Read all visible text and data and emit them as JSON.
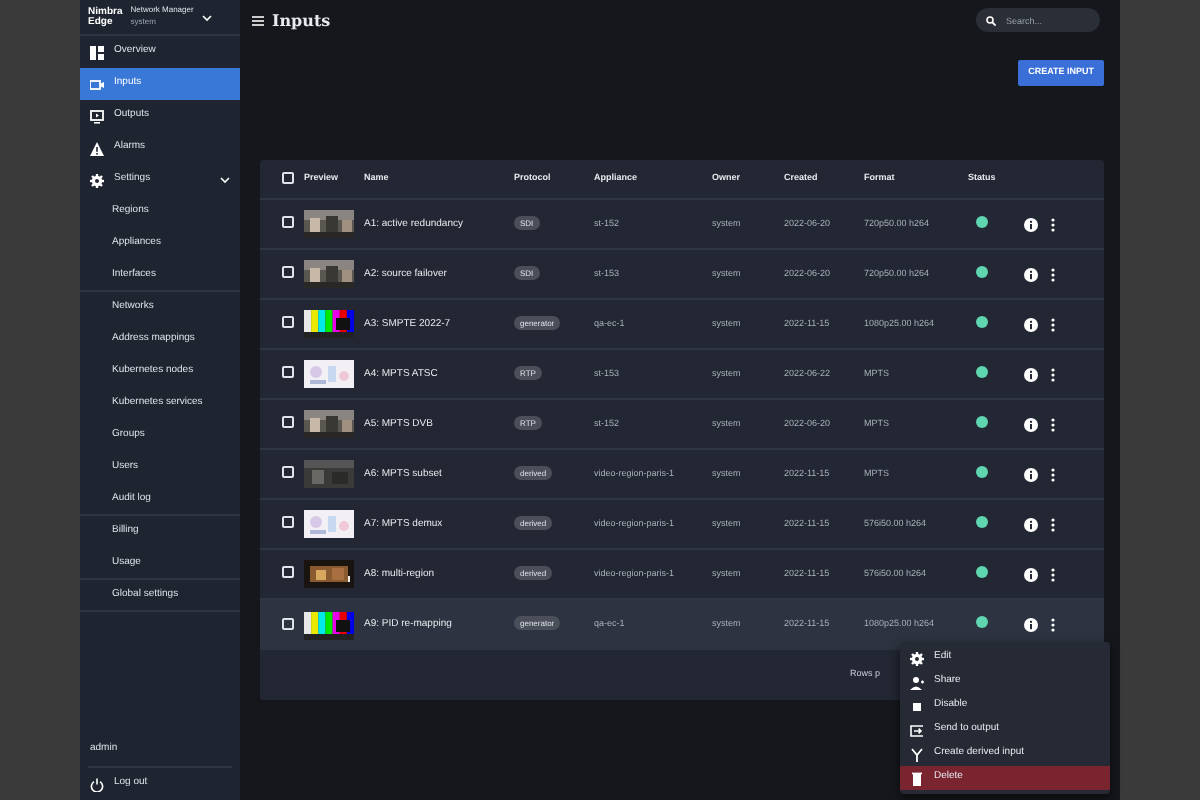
{
  "brand": {
    "logo_lines": [
      "Nimbra",
      "Edge"
    ],
    "product": "Network Manager",
    "subtitle": "system"
  },
  "sidebar": {
    "items": [
      {
        "label": "Overview",
        "selected": false
      },
      {
        "label": "Inputs",
        "selected": true
      },
      {
        "label": "Outputs",
        "selected": false
      },
      {
        "label": "Alarms",
        "selected": false
      },
      {
        "label": "Settings",
        "selected": false,
        "expanded": true,
        "children": [
          {
            "label": "Regions",
            "divider_after": false
          },
          {
            "label": "Appliances",
            "divider_after": false
          },
          {
            "label": "Interfaces",
            "divider_after": true
          },
          {
            "label": "Networks",
            "divider_after": false
          },
          {
            "label": "Address mappings",
            "divider_after": false
          },
          {
            "label": "Kubernetes nodes",
            "divider_after": false
          },
          {
            "label": "Kubernetes services",
            "divider_after": false
          },
          {
            "label": "Groups",
            "divider_after": false
          },
          {
            "label": "Users",
            "divider_after": false
          },
          {
            "label": "Audit log",
            "divider_after": true
          },
          {
            "label": "Billing",
            "divider_after": false
          },
          {
            "label": "Usage",
            "divider_after": true
          },
          {
            "label": "Global settings",
            "divider_after": true
          }
        ]
      }
    ],
    "user": "admin",
    "logout": "Log out"
  },
  "page": {
    "title": "Inputs",
    "search_placeholder": "Search...",
    "create_button": "CREATE INPUT"
  },
  "table": {
    "select_all_checked": false,
    "columns": [
      "",
      "Preview",
      "Name",
      "Protocol",
      "Appliance",
      "Owner",
      "Created",
      "Format",
      "Status",
      ""
    ],
    "rows": [
      {
        "checked": false,
        "selected": false,
        "name": "A1: active redundancy",
        "protocol": "SDI",
        "appliance": "st-152",
        "owner": "system",
        "created": "2022-06-20",
        "format": "720p50.00 h264",
        "online": true
      },
      {
        "checked": false,
        "selected": false,
        "name": "A2: source failover",
        "protocol": "SDI",
        "appliance": "st-153",
        "owner": "system",
        "created": "2022-06-20",
        "format": "720p50.00 h264",
        "online": true
      },
      {
        "checked": false,
        "selected": false,
        "name": "A3: SMPTE 2022-7",
        "protocol": "generator",
        "appliance": "qa-ec-1",
        "owner": "system",
        "created": "2022-11-15",
        "format": "1080p25.00 h264",
        "online": true
      },
      {
        "checked": false,
        "selected": false,
        "name": "A4: MPTS ATSC",
        "protocol": "RTP",
        "appliance": "st-153",
        "owner": "system",
        "created": "2022-06-22",
        "format": "MPTS",
        "online": true
      },
      {
        "checked": false,
        "selected": false,
        "name": "A5: MPTS DVB",
        "protocol": "RTP",
        "appliance": "st-152",
        "owner": "system",
        "created": "2022-06-20",
        "format": "MPTS",
        "online": true
      },
      {
        "checked": false,
        "selected": false,
        "name": "A6: MPTS subset",
        "protocol": "derived",
        "appliance": "video-region-paris-1",
        "owner": "system",
        "created": "2022-11-15",
        "format": "MPTS",
        "online": true
      },
      {
        "checked": false,
        "selected": false,
        "name": "A7: MPTS demux",
        "protocol": "derived",
        "appliance": "video-region-paris-1",
        "owner": "system",
        "created": "2022-11-15",
        "format": "576i50.00 h264",
        "online": true
      },
      {
        "checked": false,
        "selected": false,
        "name": "A8: multi-region",
        "protocol": "derived",
        "appliance": "video-region-paris-1",
        "owner": "system",
        "created": "2022-11-15",
        "format": "576i50.00 h264",
        "online": true
      },
      {
        "checked": false,
        "selected": true,
        "name": "A9: PID re-mapping",
        "protocol": "generator",
        "appliance": "qa-ec-1",
        "owner": "system",
        "created": "2022-11-15",
        "format": "1080p25.00 h264",
        "online": true
      }
    ],
    "footer": "Rows p"
  },
  "context_menu": {
    "items": [
      {
        "label": "Edit",
        "highlighted": false
      },
      {
        "label": "Share",
        "highlighted": false
      },
      {
        "label": "Disable",
        "highlighted": false
      },
      {
        "label": "Send to output",
        "highlighted": false
      },
      {
        "label": "Create derived input",
        "highlighted": false
      },
      {
        "label": "Delete",
        "highlighted": true
      }
    ]
  }
}
